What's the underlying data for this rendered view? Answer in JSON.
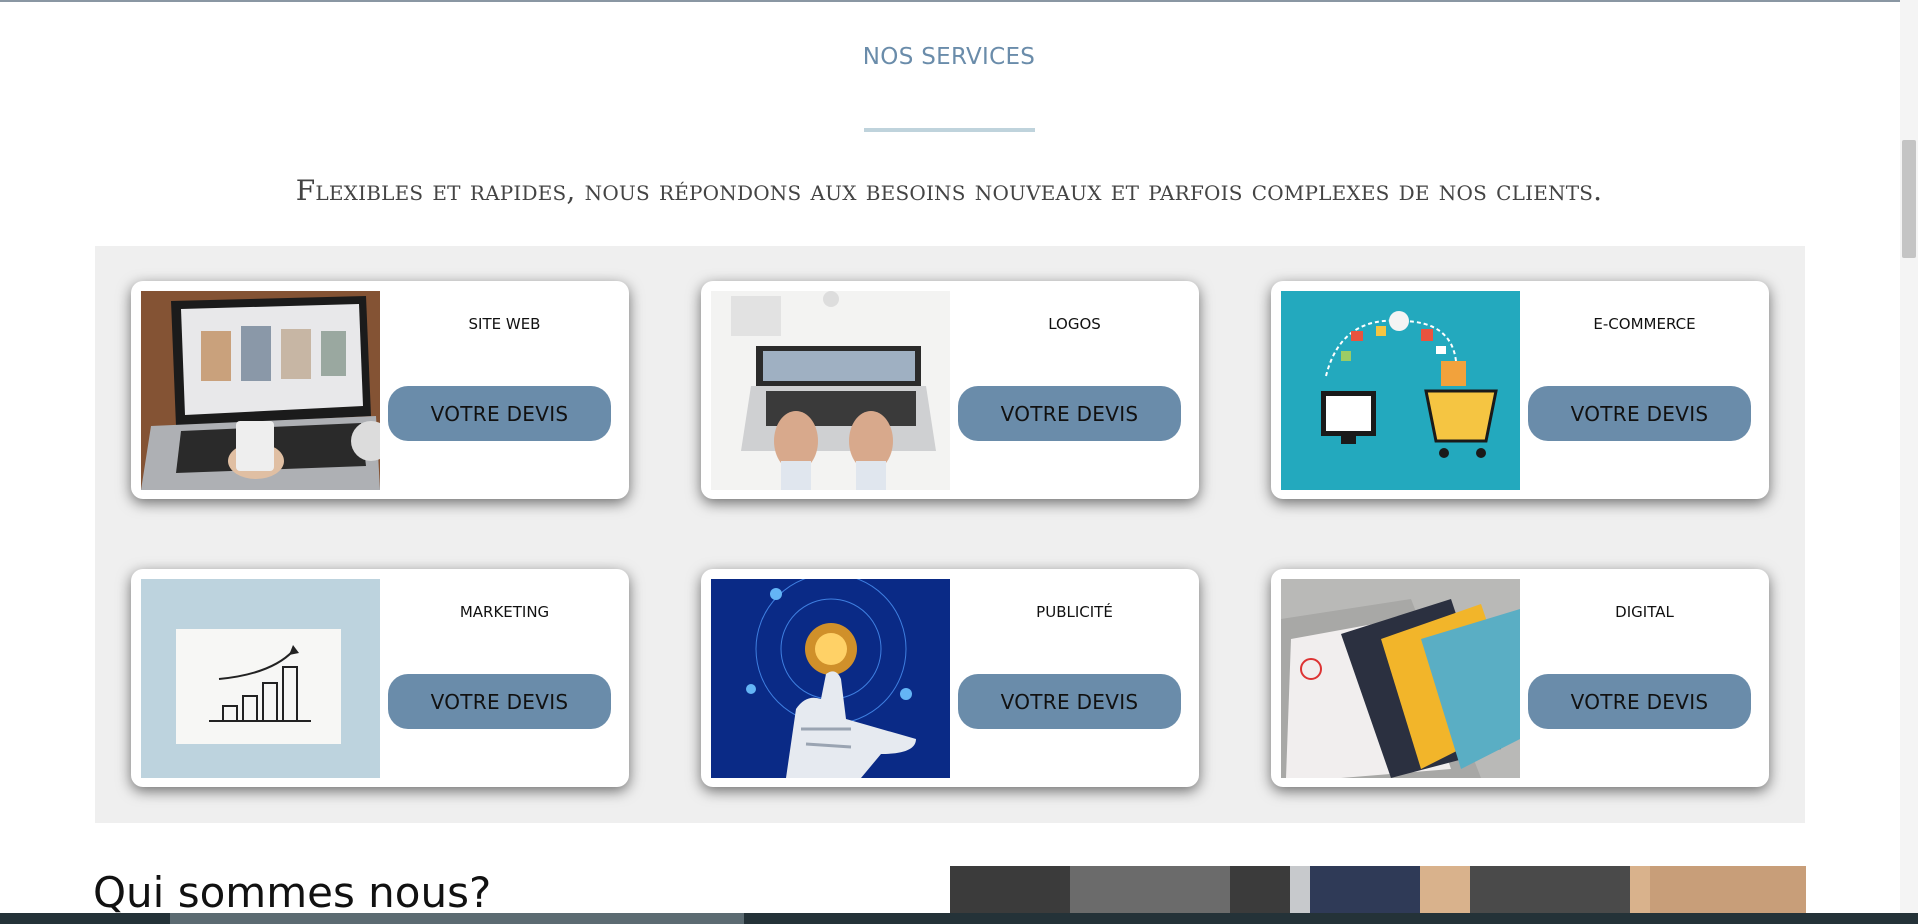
{
  "services": {
    "title": "NOS SERVICES",
    "subtitle": "Flexibles et rapides, nous répondons aux besoins nouveaux et parfois complexes de nos clients.",
    "cards": [
      {
        "title": "SITE WEB",
        "button": "VOTRE DEVIS",
        "image": "laptop-photo"
      },
      {
        "title": "LOGOS",
        "button": "VOTRE DEVIS",
        "image": "typing-laptop-photo"
      },
      {
        "title": "E-COMMERCE",
        "button": "VOTRE DEVIS",
        "image": "ecommerce-illustration"
      },
      {
        "title": "MARKETING",
        "button": "VOTRE DEVIS",
        "image": "growth-chart-photo"
      },
      {
        "title": "PUBLICITÉ",
        "button": "VOTRE DEVIS",
        "image": "robot-hand-image"
      },
      {
        "title": "DIGITAL",
        "button": "VOTRE DEVIS",
        "image": "business-cards-photo"
      }
    ]
  },
  "about": {
    "heading": "Qui sommes nous?"
  },
  "colors": {
    "accent": "#6a8caa",
    "panel": "#efefef",
    "divider": "#bfd3dc"
  }
}
